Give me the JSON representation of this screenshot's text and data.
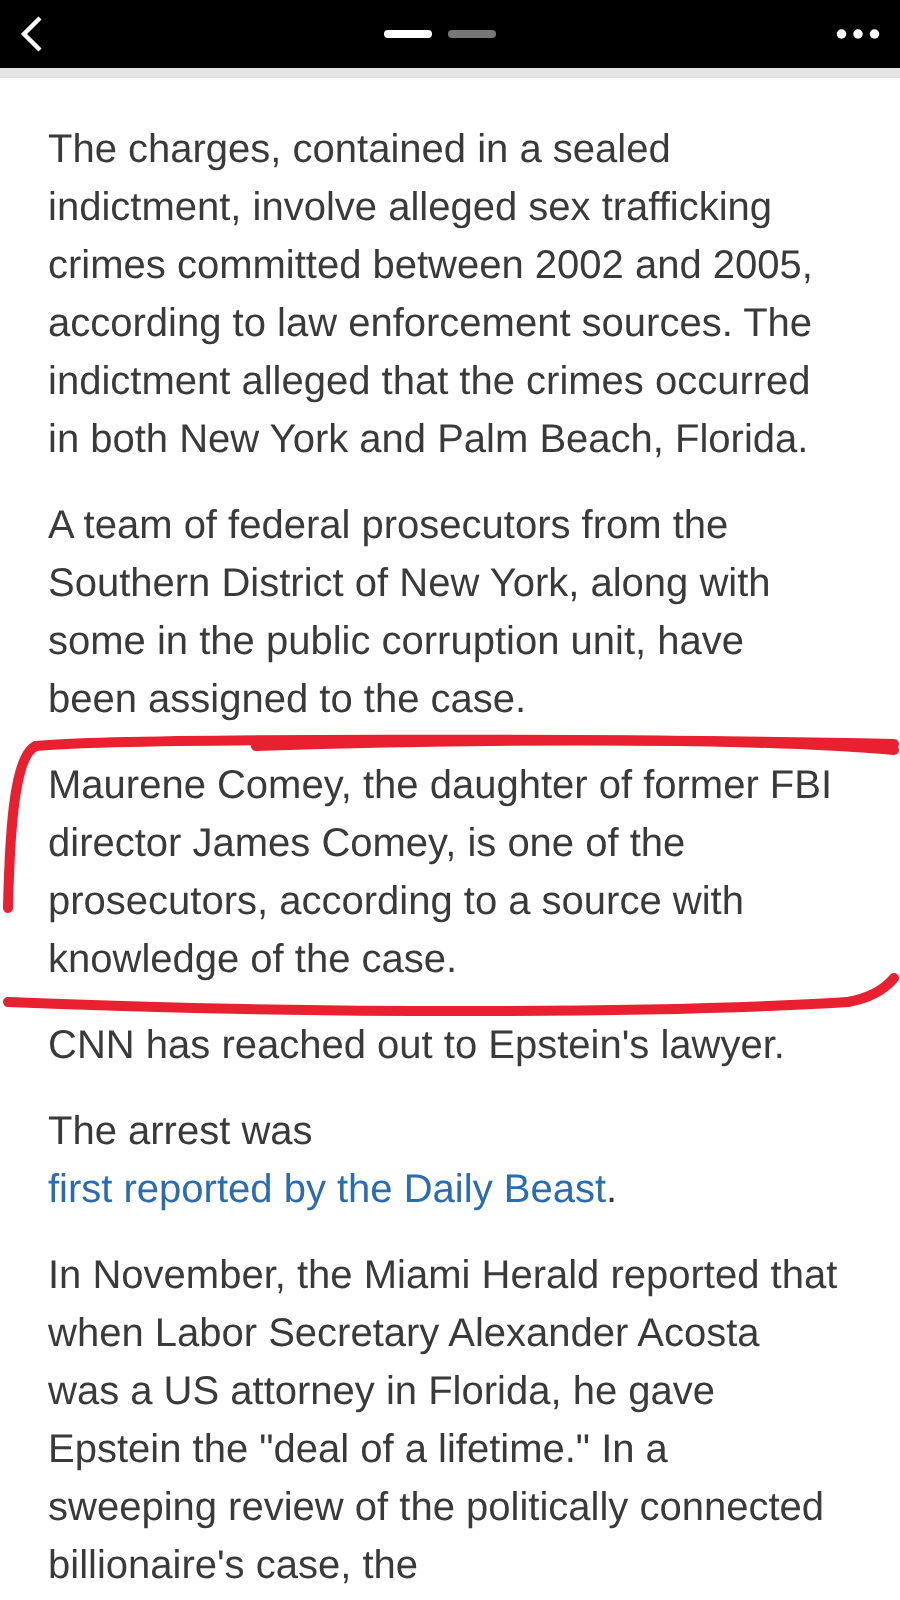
{
  "top_bar": {
    "pages": [
      {
        "selected": true
      },
      {
        "selected": false
      }
    ]
  },
  "paragraphs": [
    {
      "parts": [
        {
          "kind": "text",
          "text": "The charges, contained in a sealed indictment, involve alleged sex trafficking crimes committed between 2002 and 2005, according to law enforcement sources. The indictment alleged that the crimes occurred in both New York and Palm Beach, Florida."
        }
      ]
    },
    {
      "parts": [
        {
          "kind": "text",
          "text": "A team of federal prosecutors from the Southern District of New York, along with some in the public corruption unit, have been assigned to the case."
        }
      ]
    },
    {
      "parts": [
        {
          "kind": "text",
          "text": "Maurene Comey, the daughter of former FBI director James Comey, is one of the prosecutors, according to a source with knowledge of the case."
        }
      ]
    },
    {
      "parts": [
        {
          "kind": "text",
          "text": "CNN has reached out to Epstein's lawyer."
        }
      ]
    },
    {
      "parts": [
        {
          "kind": "text",
          "text": "The arrest was "
        },
        {
          "kind": "link",
          "text": "first reported by the Daily Beast"
        },
        {
          "kind": "text",
          "text": "."
        }
      ]
    },
    {
      "parts": [
        {
          "kind": "text",
          "text": "In November, the Miami Herald reported that when Labor Secretary Alexander Acosta was a US attorney in Florida, he gave Epstein the \"deal of a lifetime.\" In a sweeping review of the politically connected billionaire's case, the"
        }
      ]
    }
  ]
}
